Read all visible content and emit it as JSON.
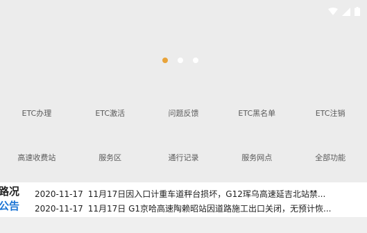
{
  "carousel": {
    "dots": [
      true,
      false,
      false
    ]
  },
  "services_row1": [
    {
      "label": "ETC办理"
    },
    {
      "label": "ETC激活"
    },
    {
      "label": "问题反馈"
    },
    {
      "label": "ETC黑名单"
    },
    {
      "label": "ETC注销"
    }
  ],
  "services_row2": [
    {
      "label": "高速收费站"
    },
    {
      "label": "服务区"
    },
    {
      "label": "通行记录"
    },
    {
      "label": "服务网点"
    },
    {
      "label": "全部功能"
    }
  ],
  "notice": {
    "label_line1": "路况",
    "label_line2": "公告",
    "items": [
      {
        "date": "2020-11-17",
        "text": "11月17日因入口计重车道秤台损坏，G12珲乌高速延吉北站禁..."
      },
      {
        "date": "2020-11-17",
        "text": "11月17日 G1京哈高速陶赖昭站因道路施工出口关闭，无预计恢..."
      }
    ]
  },
  "colors": {
    "active_dot": "#e8a33a",
    "notice_accent": "#1b74d4"
  }
}
